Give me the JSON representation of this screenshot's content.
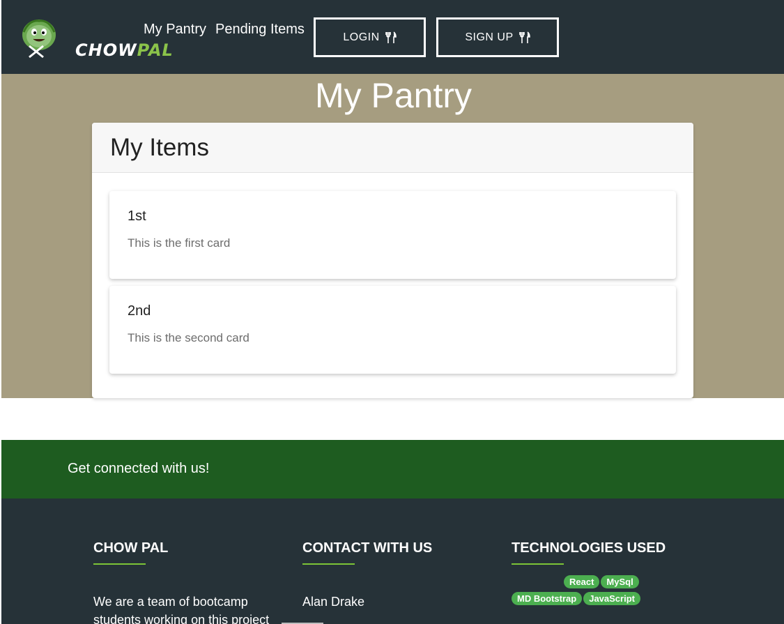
{
  "nav": {
    "logo_text_a": "CHOW",
    "logo_text_b": "PAL",
    "links": [
      {
        "label": "My Pantry"
      },
      {
        "label": "Pending Items"
      }
    ],
    "login_label": "LOGIN",
    "signup_label": "SIGN UP",
    "icons": {
      "button_icon": "fork-knife-icon"
    }
  },
  "hero": {
    "title": "My Pantry"
  },
  "panel": {
    "title": "My Items",
    "cards": [
      {
        "title": "1st",
        "text": "This is the first card"
      },
      {
        "title": "2nd",
        "text": "This is the second card"
      }
    ]
  },
  "connect": {
    "text": "Get connected with us!"
  },
  "footer": {
    "about_heading": "CHOW PAL",
    "about_text": "We are a team of bootcamp students working on this project",
    "contact_heading": "CONTACT WITH US",
    "contact_name": "Alan Drake",
    "tech_heading": "TECHNOLOGIES USED",
    "tech_badges": [
      "React",
      "MySql",
      "MD Bootstrap",
      "JavaScript"
    ]
  },
  "colors": {
    "navbar": "#263238",
    "hero": "#a69d80",
    "connect_bar": "#1e5c20",
    "accent": "#7cc537",
    "badge": "#4caf50"
  }
}
